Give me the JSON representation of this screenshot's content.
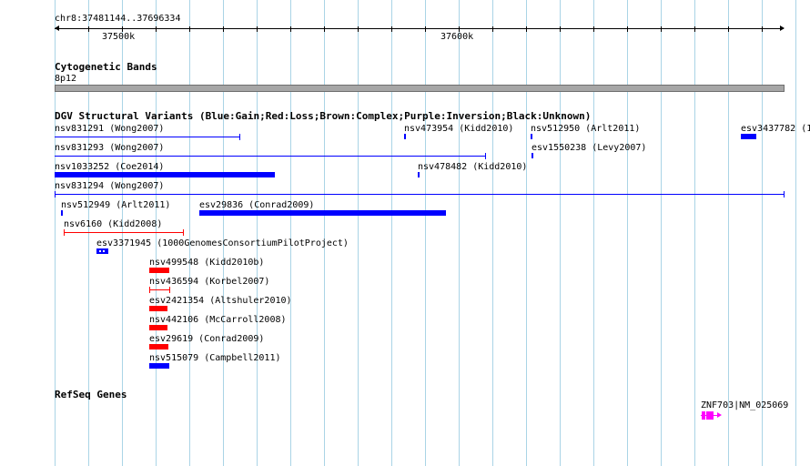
{
  "ruler": {
    "coords": "chr8:37481144..37696334",
    "tick_labels": [
      "37500k",
      "37600k"
    ]
  },
  "cytoband": {
    "title": "Cytogenetic Bands",
    "band_label": "8p12"
  },
  "dgv": {
    "title": "DGV Structural Variants (Blue:Gain;Red:Loss;Brown:Complex;Purple:Inversion;Black:Unknown)",
    "features": [
      {
        "label": "nsv831291 (Wong2007)",
        "color": "#0000ff"
      },
      {
        "label": "nsv473954 (Kidd2010)",
        "color": "#0000ff"
      },
      {
        "label": "nsv512950 (Arlt2011)",
        "color": "#0000ff"
      },
      {
        "label": "esv3437782 (1",
        "color": "#0000ff"
      },
      {
        "label": "nsv831293 (Wong2007)",
        "color": "#0000ff"
      },
      {
        "label": "esv1550238 (Levy2007)",
        "color": "#0000ff"
      },
      {
        "label": "nsv1033252 (Coe2014)",
        "color": "#0000ff"
      },
      {
        "label": "nsv478482 (Kidd2010)",
        "color": "#0000ff"
      },
      {
        "label": "nsv831294 (Wong2007)",
        "color": "#0000ff"
      },
      {
        "label": "nsv512949 (Arlt2011)",
        "color": "#0000ff"
      },
      {
        "label": "esv29836 (Conrad2009)",
        "color": "#0000ff"
      },
      {
        "label": "nsv6160 (Kidd2008)",
        "color": "#ff0000"
      },
      {
        "label": "esv3371945 (1000GenomesConsortiumPilotProject)",
        "color": "#0000ff"
      },
      {
        "label": "nsv499548 (Kidd2010b)",
        "color": "#ff0000"
      },
      {
        "label": "nsv436594 (Korbel2007)",
        "color": "#ff0000"
      },
      {
        "label": "esv2421354 (Altshuler2010)",
        "color": "#ff0000"
      },
      {
        "label": "nsv442106 (McCarroll2008)",
        "color": "#ff0000"
      },
      {
        "label": "esv29619 (Conrad2009)",
        "color": "#ff0000"
      },
      {
        "label": "nsv515079 (Campbell2011)",
        "color": "#0000ff"
      }
    ]
  },
  "refseq": {
    "title": "RefSeq Genes",
    "gene_label": "ZNF703|NM_025069",
    "gene_color": "#ff00ff"
  }
}
